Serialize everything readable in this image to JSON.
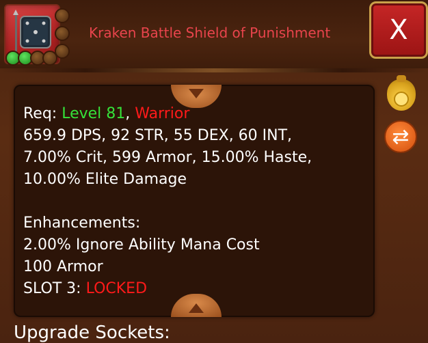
{
  "item": {
    "title": "Kraken Battle Shield of Punishment",
    "icon": "shield-icon",
    "sockets_side": 3,
    "gems": [
      "green",
      "green"
    ],
    "empty_bottom_sockets": 2
  },
  "close_button": {
    "label": "X",
    "icon": "close-icon"
  },
  "stats": {
    "req_label": "Req:",
    "req_level": "Level 81",
    "req_sep": ",",
    "req_class": "Warrior",
    "line2": "659.9 DPS, 92 STR, 55 DEX, 60 INT,",
    "line3": "7.00% Crit, 599 Armor, 15.00% Haste,",
    "line4": "10.00% Elite Damage",
    "enh_heading": "Enhancements:",
    "enh1": "2.00% Ignore Ability Mana Cost",
    "enh2": "100 Armor",
    "slot_label": "SLOT 3:",
    "slot_status": "LOCKED"
  },
  "side_buttons": {
    "sell": "coin-bag-icon",
    "swap": "swap-icon"
  },
  "sockets_section": {
    "heading": "Upgrade Sockets:"
  },
  "colors": {
    "title": "#e8444c",
    "level": "#35e23a",
    "class": "#ff1a1a",
    "locked": "#ff1a1a",
    "close_bg": "#b21a1a",
    "panel_bg": "#2c1408"
  }
}
